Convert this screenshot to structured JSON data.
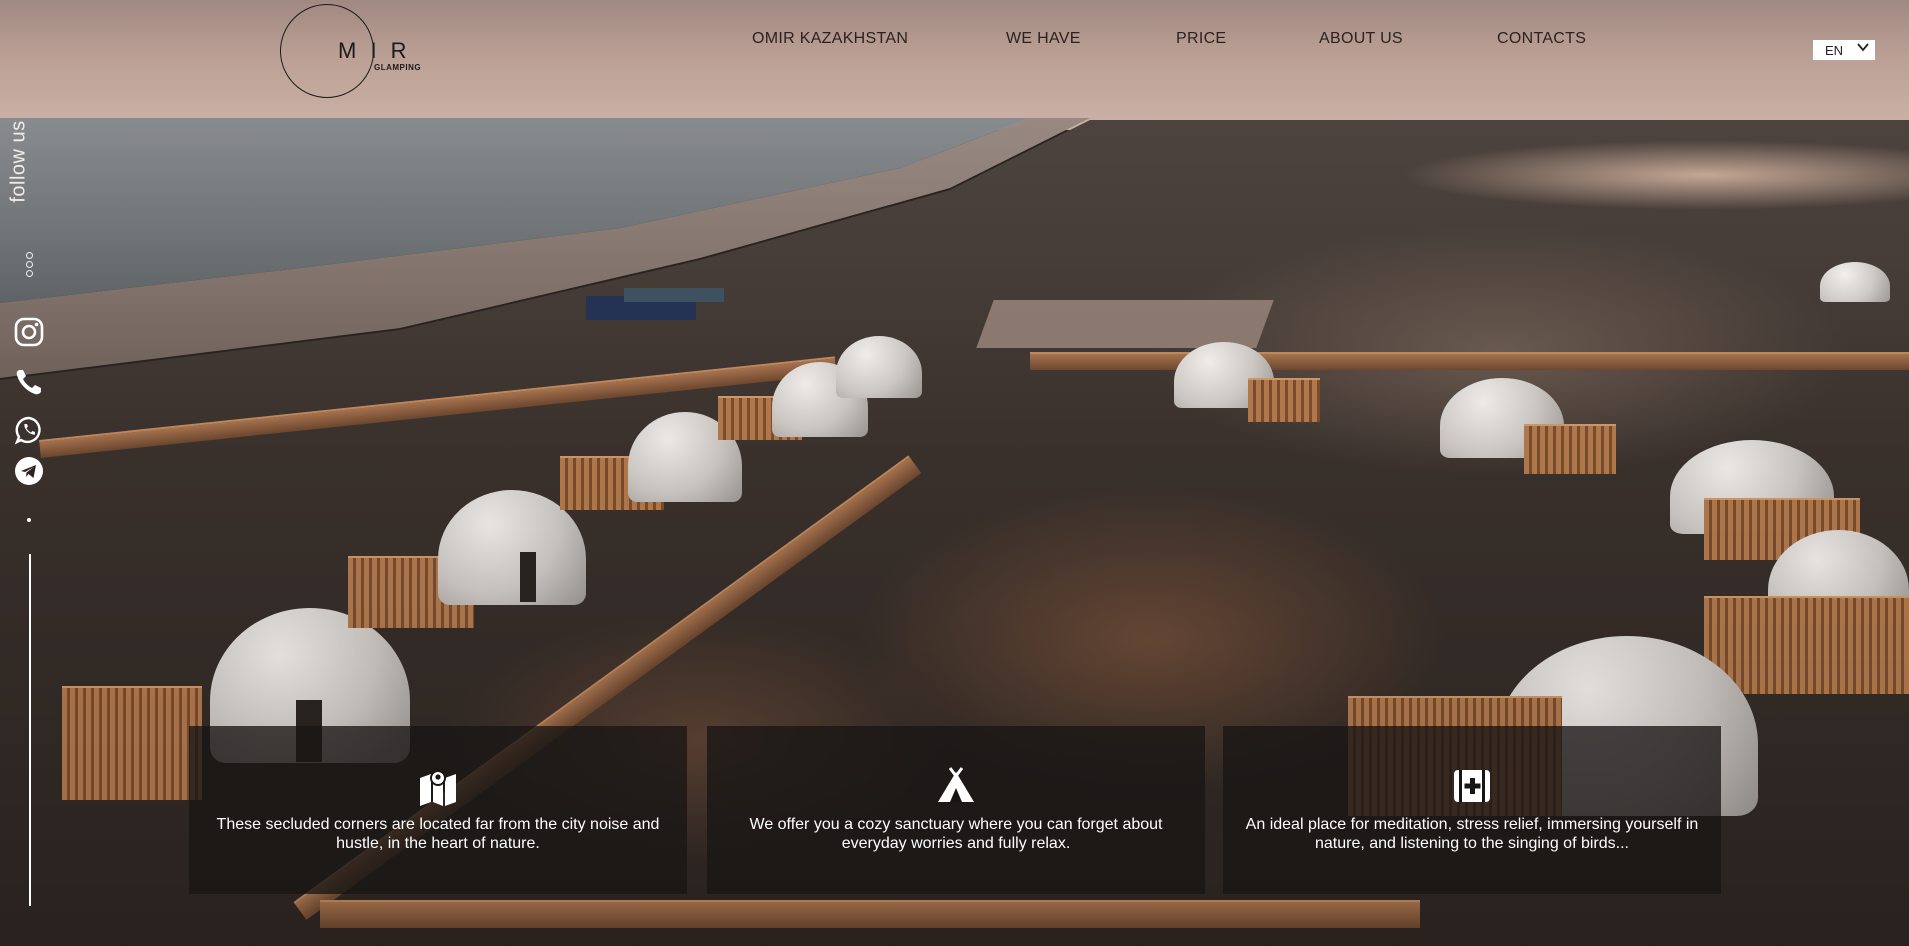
{
  "header": {
    "logo": {
      "text": "M I R",
      "subtext": "GLAMPING"
    },
    "nav": [
      {
        "label": "OMIR KAZAKHSTAN"
      },
      {
        "label": "WE HAVE"
      },
      {
        "label": "PRICE"
      },
      {
        "label": "ABOUT US"
      },
      {
        "label": "CONTACTS"
      }
    ],
    "language": {
      "selected": "EN"
    }
  },
  "sidebar": {
    "follow_label": "follow us",
    "social": [
      {
        "icon": "instagram-icon"
      },
      {
        "icon": "phone-icon"
      },
      {
        "icon": "whatsapp-icon"
      },
      {
        "icon": "telegram-icon"
      }
    ]
  },
  "features": [
    {
      "icon": "map-icon",
      "text": "These secluded corners are located far from the city noise and hustle, in the heart of nature."
    },
    {
      "icon": "tent-icon",
      "text": "We offer you a cozy sanctuary where you can forget about everyday worries and fully relax."
    },
    {
      "icon": "first-aid-icon",
      "text": "An ideal place for meditation, stress relief, immersing yourself in nature, and listening to the singing of birds..."
    }
  ],
  "colors": {
    "card_bg": "#181615",
    "text_light": "#ffffff",
    "nav_text": "#2b2220"
  }
}
